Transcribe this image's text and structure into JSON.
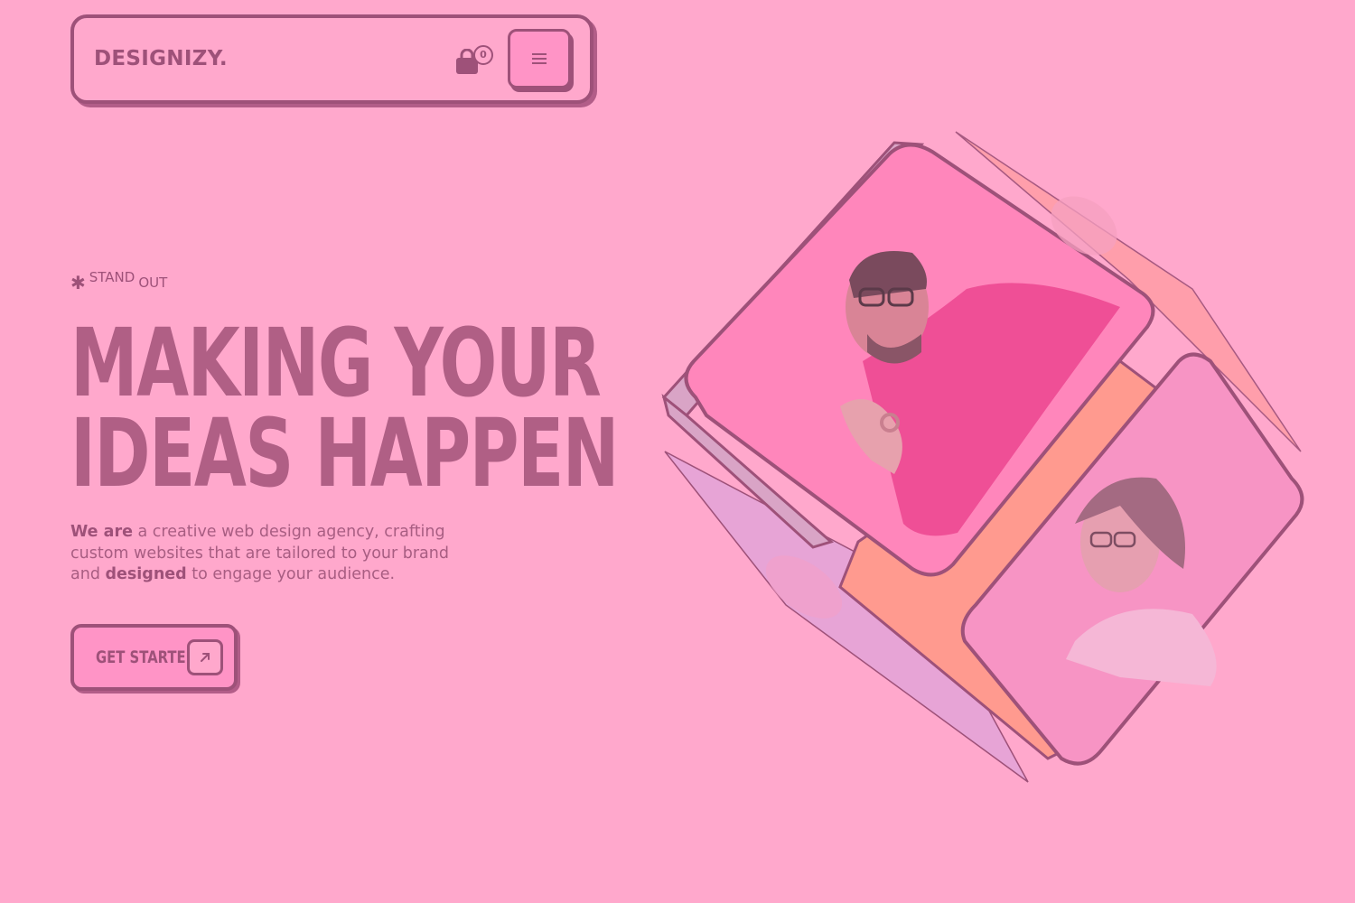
{
  "header": {
    "logo": "DESIGNIZY.",
    "cart_count": "0"
  },
  "hero": {
    "eyebrow_icon": "asterisk-icon",
    "eyebrow_word1": "STAND",
    "eyebrow_word2": "OUT",
    "headline_line1": "MAKING YOUR",
    "headline_line2": "IDEAS HAPPEN",
    "desc_bold1": "We are",
    "desc_text1": " a creative web design agency, crafting custom websites that are tailored to your brand and ",
    "desc_bold2": "designed",
    "desc_text2": " to engage your audience.",
    "cta_label": "GET STARTED"
  },
  "icons": {
    "cart": "shopping-bag-icon",
    "menu": "hamburger-menu-icon",
    "cta": "arrow-up-right-icon"
  },
  "colors": {
    "background": "#ffa8cc",
    "ink": "#9e5179",
    "button_fill": "#ff94c6",
    "accent_orange": "#ff9a8f",
    "accent_lilac": "#e7a4d6"
  }
}
